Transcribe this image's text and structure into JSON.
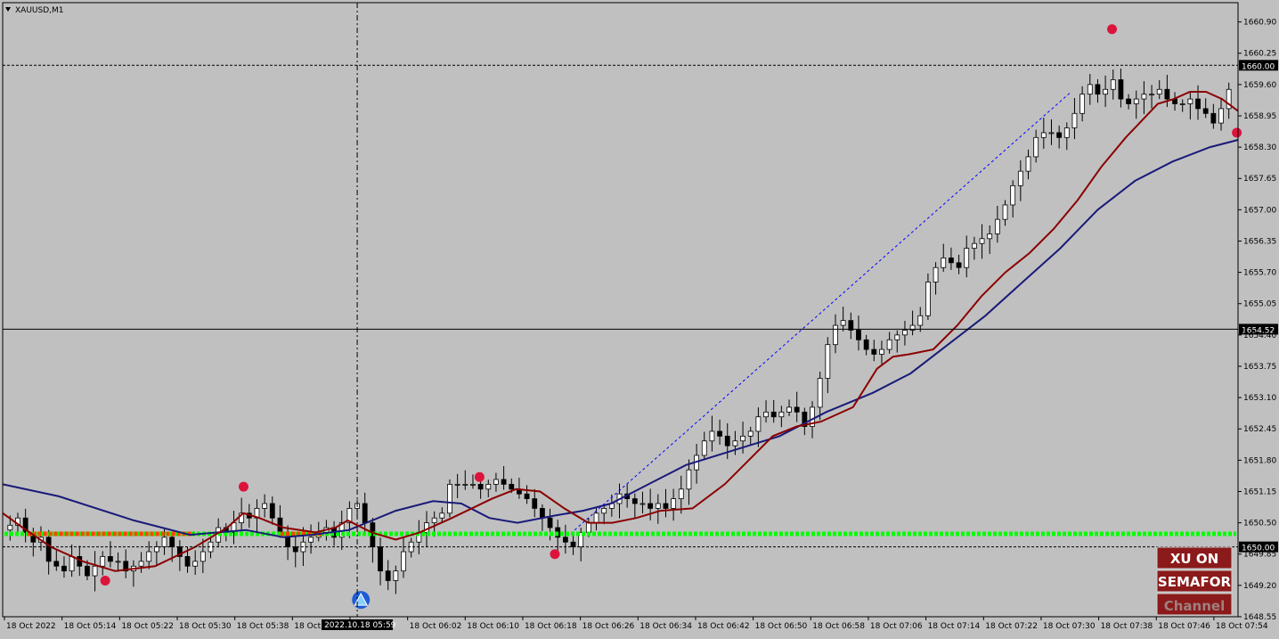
{
  "window": {
    "symbol_label": "XAUUSD,M1"
  },
  "colors": {
    "background": "#c0c0c0",
    "candle_up": "#ffffff",
    "candle_down": "#000000",
    "fast_ma": "#8b0000",
    "slow_ma": "#1a1a7a",
    "semafor_dot": "#dc143c",
    "green_line": "#00ff00",
    "orange_line": "#ff4500",
    "trendline": "#0000ff",
    "badge_bg": "#8b1a1a",
    "badge_text": "#ffffff"
  },
  "chart_data": {
    "type": "candlestick",
    "title": "XAUUSD,M1",
    "y_ticks": [
      "1660.90",
      "1660.25",
      "1659.60",
      "1658.95",
      "1658.30",
      "1657.65",
      "1657.00",
      "1656.35",
      "1655.70",
      "1655.05",
      "1654.40",
      "1653.75",
      "1653.10",
      "1652.45",
      "1651.80",
      "1651.15",
      "1650.50",
      "1649.85",
      "1649.20",
      "1648.55"
    ],
    "ylim": [
      1648.55,
      1661.3
    ],
    "x_ticks": [
      "18 Oct 2022",
      "18 Oct 05:14",
      "18 Oct 05:22",
      "18 Oct 05:30",
      "18 Oct 05:38",
      "18 Oct 05:46",
      "2022.10.18 05:59",
      "18 Oct 06:02",
      "18 Oct 06:10",
      "18 Oct 06:18",
      "18 Oct 06:26",
      "18 Oct 06:34",
      "18 Oct 06:42",
      "18 Oct 06:50",
      "18 Oct 06:58",
      "18 Oct 07:06",
      "18 Oct 07:14",
      "18 Oct 07:22",
      "18 Oct 07:30",
      "18 Oct 07:38",
      "18 Oct 07:46",
      "18 Oct 07:54"
    ],
    "price_labels": [
      {
        "value": 1660.0,
        "text": "1660.00",
        "style": "dashed"
      },
      {
        "value": 1654.52,
        "text": "1654.52",
        "style": "crosshair"
      },
      {
        "value": 1650.0,
        "text": "1650.00",
        "style": "dashed"
      }
    ],
    "crosshair_time": "2022.10.18 05:59",
    "support_level": 1650.27,
    "close_path": [
      1650.45,
      1650.6,
      1650.3,
      1650.1,
      1650.2,
      1649.7,
      1649.6,
      1649.5,
      1649.8,
      1649.6,
      1649.4,
      1649.6,
      1649.8,
      1649.7,
      1649.7,
      1649.5,
      1649.6,
      1649.7,
      1649.9,
      1650.0,
      1650.2,
      1650.0,
      1649.8,
      1649.6,
      1649.7,
      1649.9,
      1650.1,
      1650.4,
      1650.3,
      1650.5,
      1650.7,
      1650.6,
      1650.8,
      1650.9,
      1650.6,
      1650.3,
      1650.0,
      1649.9,
      1650.1,
      1650.2,
      1650.3,
      1650.4,
      1650.2,
      1650.5,
      1650.8,
      1650.9,
      1650.5,
      1650.0,
      1649.5,
      1649.3,
      1649.5,
      1649.9,
      1650.1,
      1650.3,
      1650.5,
      1650.6,
      1650.7,
      1651.3,
      1651.3,
      1651.3,
      1651.3,
      1651.2,
      1651.3,
      1651.4,
      1651.3,
      1651.2,
      1651.1,
      1651.0,
      1650.8,
      1650.6,
      1650.4,
      1650.2,
      1650.1,
      1650.0,
      1650.3,
      1650.5,
      1650.7,
      1650.8,
      1650.9,
      1651.1,
      1651.0,
      1650.9,
      1650.9,
      1650.8,
      1650.9,
      1650.8,
      1651.0,
      1651.2,
      1651.6,
      1651.9,
      1652.2,
      1652.4,
      1652.3,
      1652.1,
      1652.2,
      1652.3,
      1652.4,
      1652.7,
      1652.8,
      1652.7,
      1652.8,
      1652.9,
      1652.8,
      1652.5,
      1652.9,
      1653.5,
      1654.2,
      1654.6,
      1654.7,
      1654.5,
      1654.3,
      1654.1,
      1654.0,
      1654.1,
      1654.3,
      1654.4,
      1654.5,
      1654.6,
      1654.8,
      1655.5,
      1655.8,
      1656.0,
      1655.9,
      1655.8,
      1656.2,
      1656.3,
      1656.4,
      1656.5,
      1656.8,
      1657.1,
      1657.5,
      1657.8,
      1658.1,
      1658.5,
      1658.6,
      1658.6,
      1658.5,
      1658.7,
      1659.0,
      1659.4,
      1659.6,
      1659.4,
      1659.5,
      1659.7,
      1659.3,
      1659.2,
      1659.3,
      1659.4,
      1659.4,
      1659.5,
      1659.3,
      1659.2,
      1659.2,
      1659.3,
      1659.1,
      1659.0,
      1658.8,
      1659.1,
      1659.5
    ],
    "fast_ma": [
      [
        1650.7,
        0
      ],
      [
        1650.4,
        5
      ],
      [
        1650.0,
        12
      ],
      [
        1649.7,
        20
      ],
      [
        1649.5,
        28
      ],
      [
        1649.6,
        38
      ],
      [
        1650.0,
        48
      ],
      [
        1650.4,
        56
      ],
      [
        1650.7,
        60
      ],
      [
        1650.6,
        64
      ],
      [
        1650.4,
        70
      ],
      [
        1650.3,
        78
      ],
      [
        1650.4,
        83
      ],
      [
        1650.55,
        86
      ],
      [
        1650.3,
        92
      ],
      [
        1650.15,
        98
      ],
      [
        1650.3,
        104
      ],
      [
        1650.6,
        112
      ],
      [
        1651.0,
        122
      ],
      [
        1651.2,
        128
      ],
      [
        1651.15,
        134
      ],
      [
        1650.8,
        140
      ],
      [
        1650.5,
        146
      ],
      [
        1650.5,
        152
      ],
      [
        1650.6,
        158
      ],
      [
        1650.75,
        164
      ],
      [
        1650.8,
        172
      ],
      [
        1651.3,
        180
      ],
      [
        1651.8,
        186
      ],
      [
        1652.3,
        192
      ],
      [
        1652.5,
        198
      ],
      [
        1652.6,
        204
      ],
      [
        1652.9,
        212
      ],
      [
        1653.7,
        218
      ],
      [
        1653.95,
        222
      ],
      [
        1654.0,
        226
      ],
      [
        1654.1,
        232
      ],
      [
        1654.6,
        238
      ],
      [
        1655.2,
        244
      ],
      [
        1655.7,
        250
      ],
      [
        1656.1,
        256
      ],
      [
        1656.6,
        262
      ],
      [
        1657.2,
        268
      ],
      [
        1657.9,
        274
      ],
      [
        1658.5,
        280
      ],
      [
        1658.85,
        284
      ],
      [
        1659.2,
        288
      ],
      [
        1659.3,
        292
      ],
      [
        1659.45,
        296
      ],
      [
        1659.45,
        300
      ],
      [
        1659.3,
        304
      ],
      [
        1659.05,
        308
      ]
    ],
    "slow_ma": [
      [
        1651.3,
        0
      ],
      [
        1651.05,
        12
      ],
      [
        1650.55,
        28
      ],
      [
        1650.25,
        40
      ],
      [
        1650.35,
        52
      ],
      [
        1650.2,
        60
      ],
      [
        1650.25,
        66
      ],
      [
        1650.35,
        74
      ],
      [
        1650.75,
        84
      ],
      [
        1650.95,
        92
      ],
      [
        1650.9,
        98
      ],
      [
        1650.6,
        104
      ],
      [
        1650.5,
        110
      ],
      [
        1650.65,
        118
      ],
      [
        1650.75,
        124
      ],
      [
        1650.9,
        130
      ],
      [
        1651.3,
        138
      ],
      [
        1651.7,
        146
      ],
      [
        1652.0,
        156
      ],
      [
        1652.3,
        166
      ],
      [
        1652.8,
        176
      ],
      [
        1653.2,
        186
      ],
      [
        1653.6,
        194
      ],
      [
        1654.2,
        202
      ],
      [
        1654.8,
        210
      ],
      [
        1655.5,
        218
      ],
      [
        1656.2,
        226
      ],
      [
        1657.0,
        234
      ],
      [
        1657.6,
        242
      ],
      [
        1658.0,
        250
      ],
      [
        1658.3,
        258
      ],
      [
        1658.45,
        264
      ]
    ],
    "semafor_points": [
      {
        "price": 1649.3,
        "pos": 0.083,
        "kind": "low"
      },
      {
        "price": 1651.25,
        "pos": 0.195,
        "kind": "high"
      },
      {
        "price": 1651.45,
        "pos": 0.386,
        "kind": "high"
      },
      {
        "price": 1649.85,
        "pos": 0.447,
        "kind": "low"
      },
      {
        "price": 1660.75,
        "pos": 0.898,
        "kind": "high"
      },
      {
        "price": 1658.6,
        "pos": 0.999,
        "kind": "low"
      }
    ],
    "trendline": {
      "from": [
        1650.35,
        0.463
      ],
      "to": [
        1659.45,
        0.865
      ]
    },
    "blue_signal": {
      "price": 1648.9,
      "pos": 0.29
    }
  },
  "badges": {
    "line1": "XU ON",
    "line2": "SEMAFOR",
    "line3": "Channel"
  }
}
